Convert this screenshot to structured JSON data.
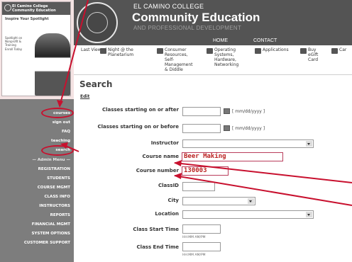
{
  "promo": {
    "heading": "El Camino College Community Education",
    "subhead": "Inspire Your Spotlight",
    "text_a": "Spotlight on Nonprofit & Training",
    "text_b": "Enroll Today"
  },
  "header": {
    "college": "EL CAMINO COLLEGE",
    "title": "Community Education",
    "subtitle": "AND PROFESSIONAL DEVELOPMENT",
    "home_link": "HOME",
    "contact_link": "CONTACT"
  },
  "icon_row": [
    {
      "label": "Last\nViewed"
    },
    {
      "label": "Night @ the\nPlanetarium"
    },
    {
      "label": "Consumer\nResources,\nSelf-\nManagement\n& Diddle"
    },
    {
      "label": "Operating\nSystems,\nHardware,\nNetworking"
    },
    {
      "label": "Applications"
    },
    {
      "label": "Buy\neGift\nCard"
    },
    {
      "label": "Car"
    }
  ],
  "sidebar": {
    "courses": "courses",
    "sign_out": "sign out",
    "faq": "FAQ",
    "teaching": "teaching",
    "search": "search",
    "admin_menu": "— Admin Menu —",
    "registration": "REGISTRATION",
    "students": "STUDENTS",
    "course_mgmt": "COURSE MGMT",
    "class_info": "CLASS INFO",
    "instructors": "INSTRUCTORS",
    "reports": "REPORTS",
    "financial_mgmt": "FINANCIAL MGMT",
    "system_options": "SYSTEM OPTIONS",
    "customer_support": "CUSTOMER SUPPORT"
  },
  "page": {
    "title": "Search",
    "edit": "Edit",
    "date_hint": "[ mm/dd/yyyy ]"
  },
  "form": {
    "starting_after_label": "Classes starting on or after",
    "starting_before_label": "Classes starting on or before",
    "instructor_label": "Instructor",
    "course_name_label": "Course name",
    "course_name_value": "Beer Making",
    "course_number_label": "Course number",
    "course_number_value": "130003",
    "classid_label": "ClassID",
    "city_label": "City",
    "location_label": "Location",
    "start_time_label": "Class Start Time",
    "end_time_label": "Class End Time",
    "time_hint": "HH:MM AM/PM"
  },
  "colors": {
    "annotation": "#c8102e",
    "sidebar": "#7d7d7d",
    "header": "#545454",
    "background": "#f4e3e3"
  }
}
